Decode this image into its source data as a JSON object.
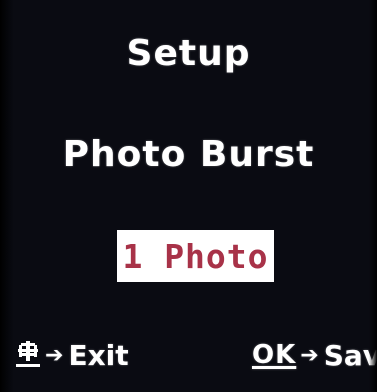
{
  "screen": {
    "title": "Setup",
    "menu_item": "Photo Burst",
    "selected_value": "1 Photo"
  },
  "footer": {
    "exit": {
      "key_icon": "menu-key-icon",
      "arrow_icon": "arrow-right-icon",
      "label": "Exit"
    },
    "save": {
      "key_label": "OK",
      "arrow_icon": "arrow-right-icon",
      "label": "Save"
    }
  },
  "colors": {
    "background": "#0a0b12",
    "text": "#ffffff",
    "value_box": "#ffffff",
    "value_text": "#a83248"
  }
}
